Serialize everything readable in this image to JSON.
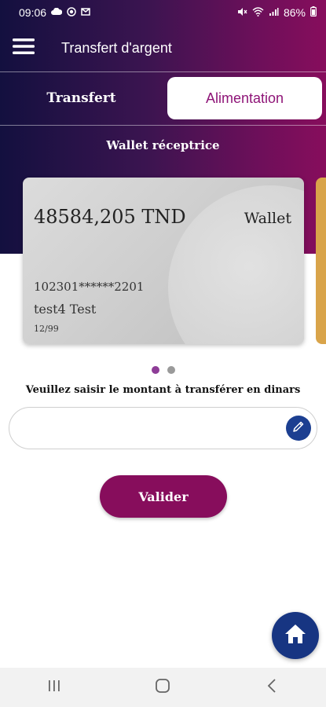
{
  "status_bar": {
    "time": "09:06",
    "battery": "86%"
  },
  "app_bar": {
    "title": "Transfert d'argent"
  },
  "tabs": [
    {
      "label": "Transfert",
      "active": false
    },
    {
      "label": "Alimentation",
      "active": true
    }
  ],
  "section": {
    "label": "Wallet réceptrice"
  },
  "card": {
    "balance": "48584,205 TND",
    "type": "Wallet",
    "number": "102301******2201",
    "holder": "test4 Test",
    "expiry": "12/99"
  },
  "pager": {
    "count": 2,
    "active_index": 0
  },
  "form": {
    "prompt": "Veuillez saisir le montant à transférer en dinars",
    "amount_value": "",
    "validate_label": "Valider"
  },
  "colors": {
    "accent": "#870d5c",
    "tab_active_text": "#8e1477",
    "fab": "#173582"
  },
  "icons": {
    "menu": "hamburger-menu-icon",
    "edit": "pencil-icon",
    "home": "home-icon"
  }
}
